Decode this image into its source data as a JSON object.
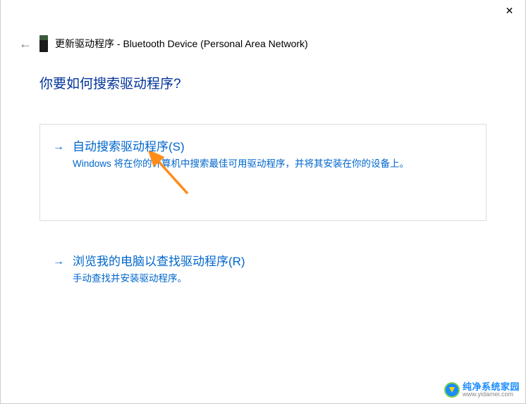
{
  "titlebar": {
    "close_glyph": "✕"
  },
  "header": {
    "back_glyph": "←",
    "title": "更新驱动程序 - Bluetooth Device (Personal Area Network)"
  },
  "heading": "你要如何搜索驱动程序?",
  "options": [
    {
      "arrow": "→",
      "title": "自动搜索驱动程序(S)",
      "desc": "Windows 将在你的计算机中搜索最佳可用驱动程序，并将其安装在你的设备上。"
    },
    {
      "arrow": "→",
      "title": "浏览我的电脑以查找驱动程序(R)",
      "desc": "手动查找并安装驱动程序。"
    }
  ],
  "watermark": {
    "title": "纯净系统家园",
    "url": "www.yidamei.com"
  }
}
